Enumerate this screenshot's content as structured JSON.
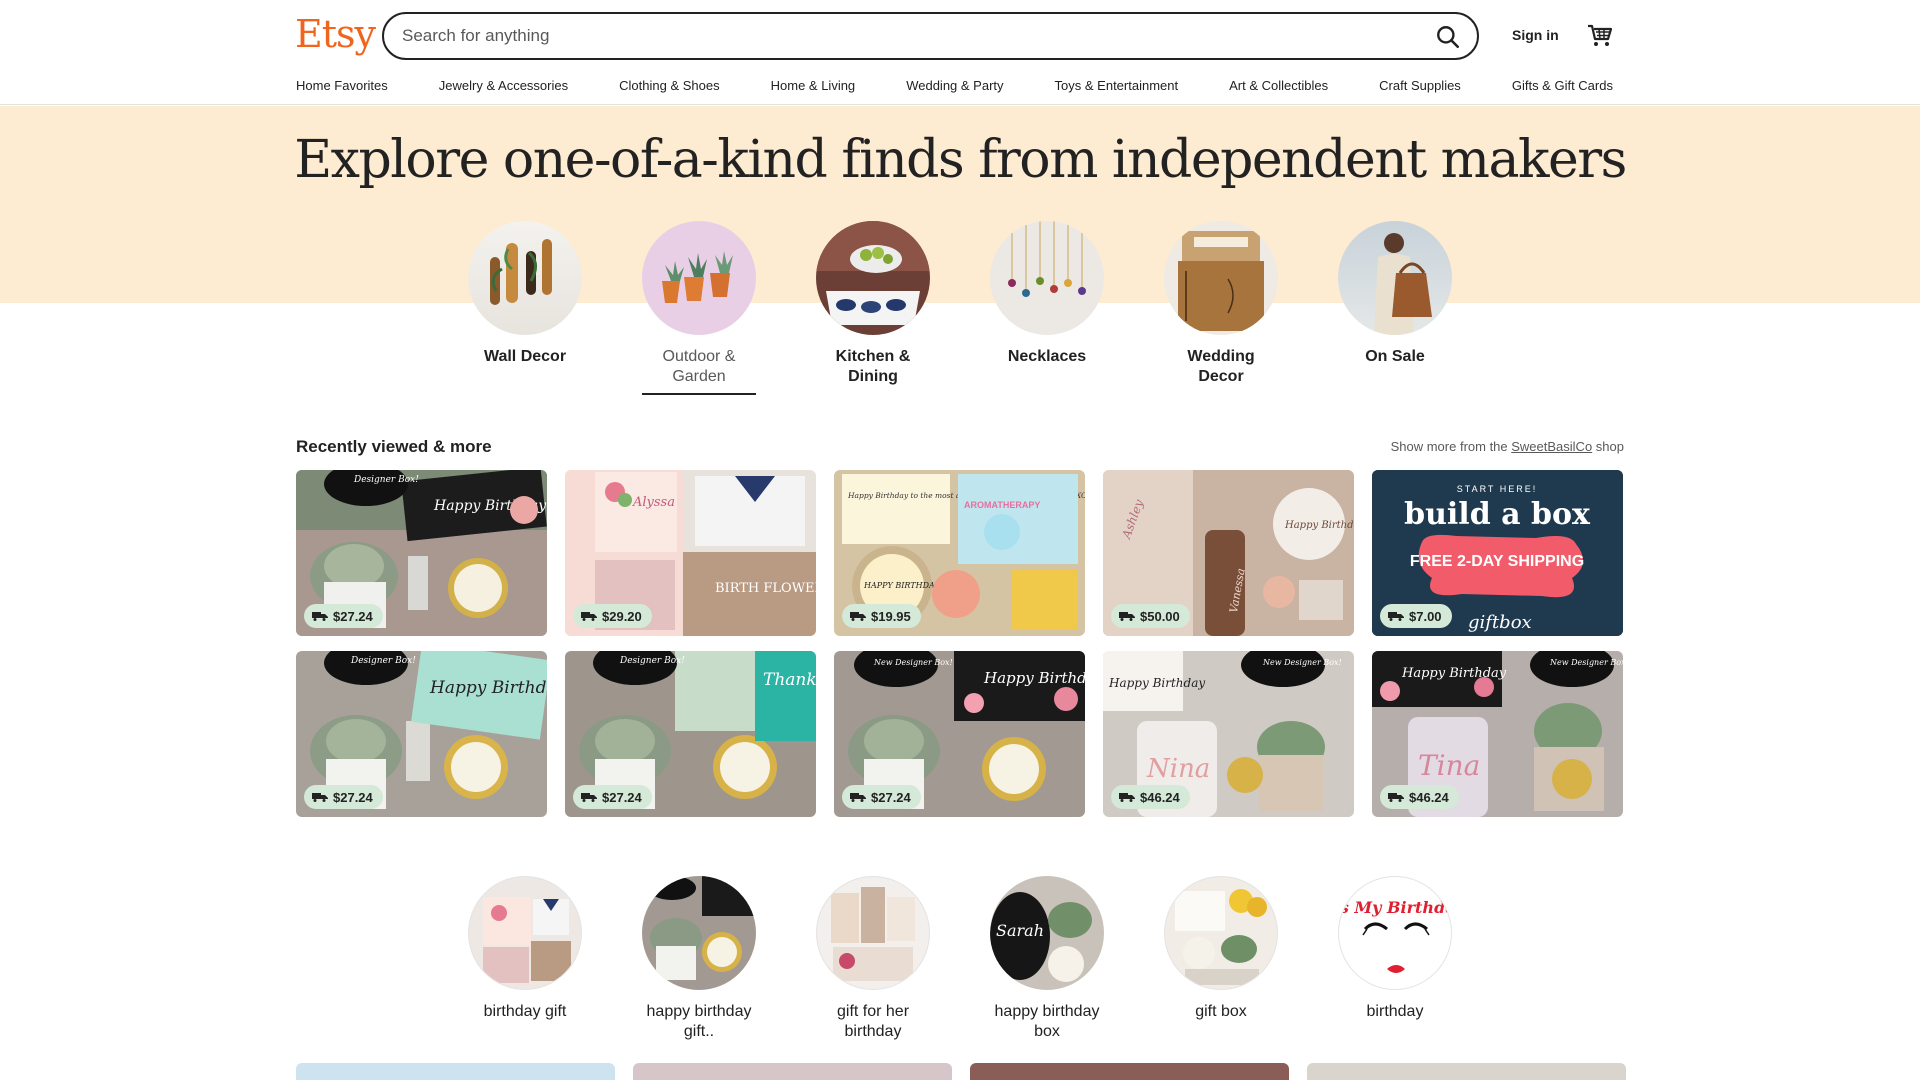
{
  "header": {
    "logo": "Etsy",
    "search_placeholder": "Search for anything",
    "signin": "Sign in",
    "categories": [
      "Home Favorites",
      "Jewelry & Accessories",
      "Clothing & Shoes",
      "Home & Living",
      "Wedding & Party",
      "Toys & Entertainment",
      "Art & Collectibles",
      "Craft Supplies",
      "Gifts & Gift Cards"
    ]
  },
  "hero": {
    "title": "Explore one-of-a-kind finds from independent makers",
    "circles": [
      {
        "label": "Wall Decor",
        "icon": "wall-decor-image"
      },
      {
        "label": "Outdoor & Garden",
        "icon": "succulent-pots-image"
      },
      {
        "label": "Kitchen & Dining",
        "icon": "tableware-image"
      },
      {
        "label": "Necklaces",
        "icon": "necklaces-image"
      },
      {
        "label": "Wedding Decor",
        "icon": "guest-book-image"
      },
      {
        "label": "On Sale",
        "icon": "tote-bag-image"
      }
    ]
  },
  "recent": {
    "title": "Recently viewed & more",
    "more_prefix": "Show more from the ",
    "shop_name": "SweetBasilCo",
    "more_suffix": " shop",
    "items": [
      {
        "price": "$27.24"
      },
      {
        "price": "$29.20"
      },
      {
        "price": "$19.95"
      },
      {
        "price": "$50.00"
      },
      {
        "price": "$7.00"
      },
      {
        "price": "$27.24"
      },
      {
        "price": "$27.24"
      },
      {
        "price": "$27.24"
      },
      {
        "price": "$46.24"
      },
      {
        "price": "$46.24"
      }
    ],
    "card_texts": {
      "happy_birthday": "Happy Birthday",
      "designer_box": "Designer Box!",
      "new_designer_box": "New Designer Box!",
      "birth_flower": "BIRTH FLOWER",
      "alyssa": "Alyssa",
      "sister_msg": "Happy Birthday to the most amazing sister in the world. XOXOXO Sarah",
      "happy_birthday_to_you": "HAPPY BIRTHDAY TO YOU",
      "aromatherapy": "AROMATHERAPY",
      "ashley": "Ashley",
      "vanessa": "Vanessa",
      "start_here": "START HERE!",
      "build_a_box": "build a box",
      "free_shipping": "FREE 2-DAY SHIPPING",
      "giftbox": "giftbox",
      "thank_you": "Thank You",
      "nina": "Nina",
      "tina": "Tina"
    }
  },
  "suggestions": [
    {
      "label": "birthday gift"
    },
    {
      "label": "happy birthday gift.."
    },
    {
      "label": "gift for her birthday"
    },
    {
      "label": "happy birthday box"
    },
    {
      "label": "gift box"
    },
    {
      "label": "birthday"
    }
  ],
  "suggestion_texts": {
    "sarah": "Sarah",
    "its_my_birthday": "It's My Birthday!"
  }
}
